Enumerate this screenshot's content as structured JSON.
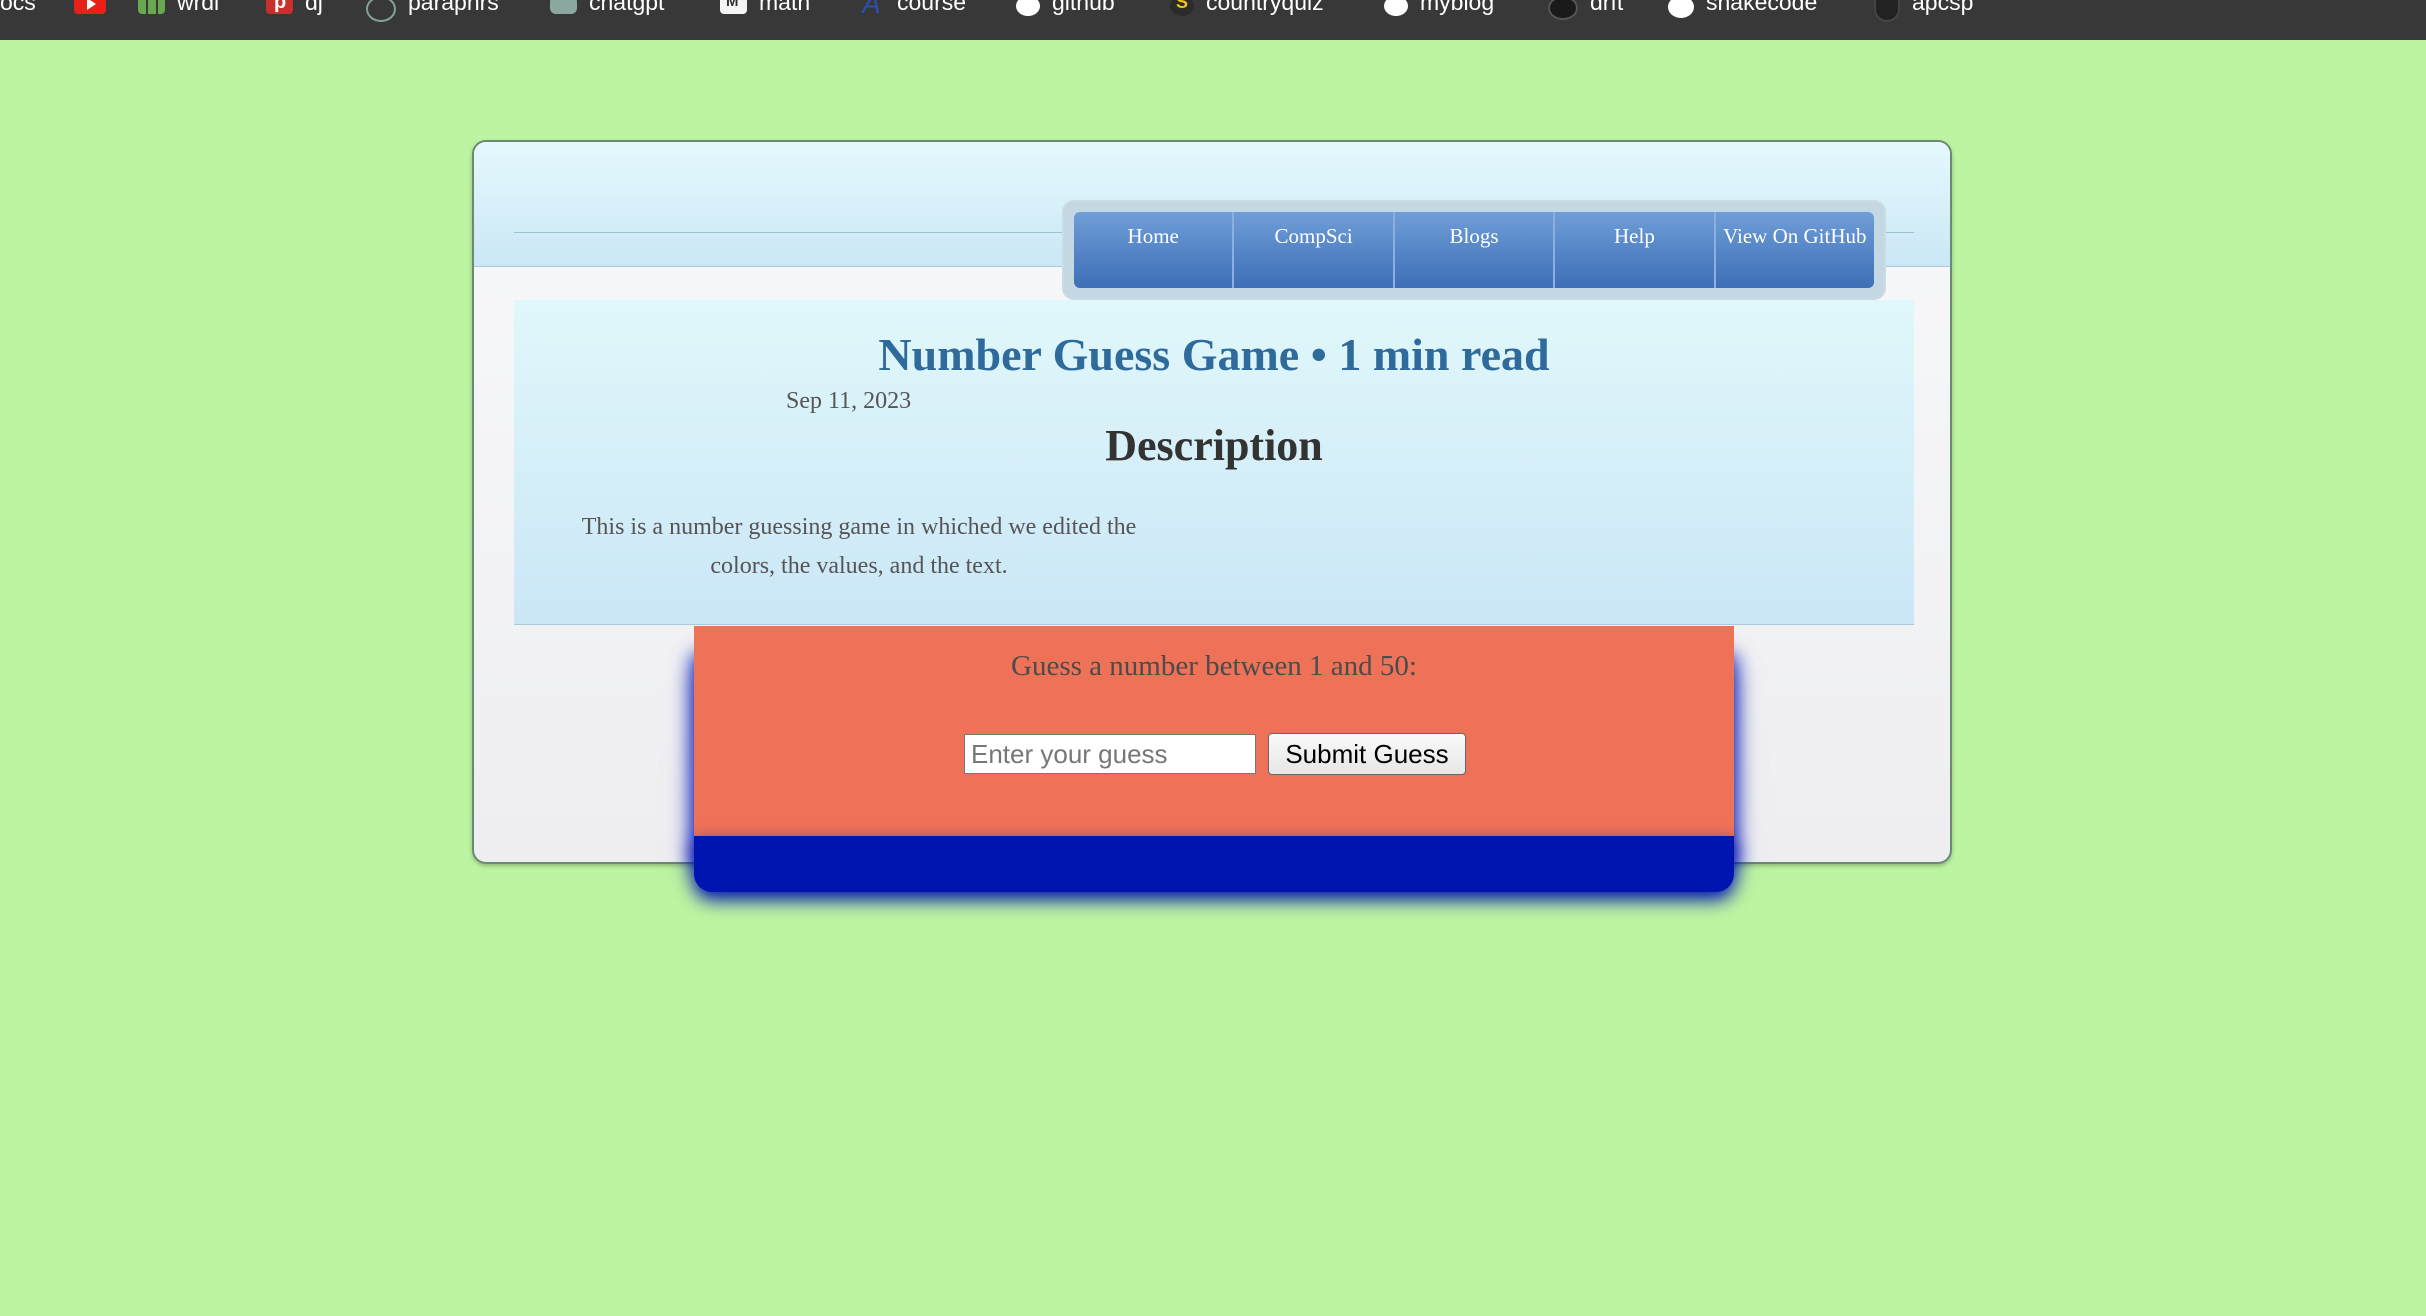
{
  "bookmarks": [
    {
      "label": "ocs",
      "icon": "none"
    },
    {
      "label": "",
      "icon": "youtube-icon"
    },
    {
      "label": "wrdl",
      "icon": "grid-icon"
    },
    {
      "label": "dj",
      "icon": "p-icon"
    },
    {
      "label": "paraphrs",
      "icon": "paraphrase-icon"
    },
    {
      "label": "chatgpt",
      "icon": "chatgpt-icon"
    },
    {
      "label": "math",
      "icon": "ml-icon"
    },
    {
      "label": "course",
      "icon": "course-icon"
    },
    {
      "label": "github",
      "icon": "globe-icon"
    },
    {
      "label": "countryquiz",
      "icon": "countryquiz-icon"
    },
    {
      "label": "myblog",
      "icon": "globe-icon"
    },
    {
      "label": "drft",
      "icon": "drft-icon"
    },
    {
      "label": "snakecode",
      "icon": "github-icon"
    },
    {
      "label": "apcsp",
      "icon": "shield-icon"
    }
  ],
  "nav": {
    "items": [
      "Home",
      "CompSci",
      "Blogs",
      "Help",
      "View On GitHub"
    ]
  },
  "post": {
    "title": "Number Guess Game • 1 min read",
    "date": "Sep 11, 2023",
    "section_title": "Description",
    "description": "This is a number guessing game in whiched we edited the colors, the values, and the text."
  },
  "game": {
    "prompt": "Guess a number between 1 and 50:",
    "input_placeholder": "Enter your guess",
    "input_value": "",
    "submit_label": "Submit Guess"
  },
  "colors": {
    "page_background": "#bdf4a1",
    "game_box": "#ee7257",
    "game_shadow": "#0014b0",
    "title": "#2e6a9b",
    "nav": "#4f7fc4"
  }
}
